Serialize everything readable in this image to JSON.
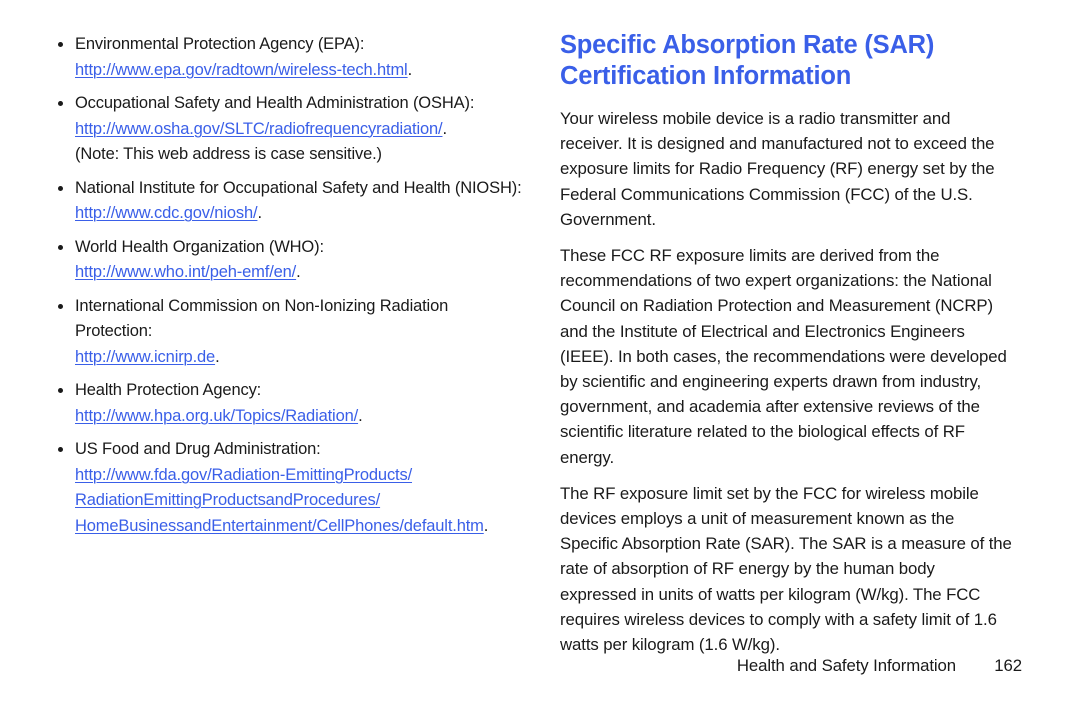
{
  "left_column": {
    "bullets": [
      {
        "label": "Environmental Protection Agency (EPA):",
        "link": "http://www.epa.gov/radtown/wireless-tech.html",
        "trailing": ".",
        "note": ""
      },
      {
        "label": "Occupational Safety and Health Administration (OSHA):",
        "link": "http://www.osha.gov/SLTC/radiofrequencyradiation/",
        "trailing": ".",
        "note": "(Note: This web address is case sensitive.)"
      },
      {
        "label": "National Institute for Occupational Safety and Health (NIOSH):",
        "link": "http://www.cdc.gov/niosh/",
        "trailing": ".",
        "note": ""
      },
      {
        "label": "World Health Organization (WHO):",
        "link": "http://www.who.int/peh-emf/en/",
        "trailing": ".",
        "note": ""
      },
      {
        "label": "International Commission on Non-Ionizing Radiation Protection:",
        "link": "http://www.icnirp.de",
        "trailing": ".",
        "note": ""
      },
      {
        "label": "Health Protection Agency:",
        "link": "http://www.hpa.org.uk/Topics/Radiation/",
        "trailing": ".",
        "note": ""
      },
      {
        "label": "US Food and Drug Administration:",
        "link_line_1": "http://www.fda.gov/Radiation-EmittingProducts/",
        "link_line_2": "RadiationEmittingProductsandProcedures/",
        "link_line_3": "HomeBusinessandEntertainment/CellPhones/default.htm",
        "trailing": ".",
        "note": ""
      }
    ]
  },
  "right_column": {
    "heading_line_1": "Specific Absorption Rate (SAR)",
    "heading_line_2": "Certification Information",
    "paragraphs": [
      {
        "lines": [
          "Your wireless mobile device is a radio transmitter and",
          "receiver. It is designed and manufactured not to exceed the",
          "exposure limits for Radio Frequency (RF) energy set by the",
          "Federal Communications Commission (FCC) of the U.S.",
          "Government."
        ]
      },
      {
        "lines": [
          "These FCC RF exposure limits are derived from the",
          "recommendations of two expert organizations: the National",
          "Council on Radiation Protection and Measurement (NCRP)",
          "and the Institute of Electrical and Electronics Engineers",
          "(IEEE). In both cases, the recommendations were developed",
          "by scientific and engineering experts drawn from industry,",
          "government, and academia after extensive reviews of the",
          "scientific literature related to the biological effects of RF",
          "energy."
        ]
      },
      {
        "lines": [
          "The RF exposure limit set by the FCC for wireless mobile",
          "devices employs a unit of measurement known as the",
          "Specific Absorption Rate (SAR). The SAR is a measure of the",
          "rate of absorption of RF energy by the human body",
          "expressed in units of watts per kilogram (W/kg). The FCC",
          "requires wireless devices to comply with a safety limit of 1.6",
          "watts per kilogram (1.6 W/kg)."
        ]
      }
    ]
  },
  "footer": {
    "title": "Health and Safety Information",
    "page_number": "162"
  },
  "colors": {
    "link": "#3a5fe8",
    "heading": "#3a5fe8",
    "text": "#1a1a1a",
    "background": "#ffffff"
  }
}
